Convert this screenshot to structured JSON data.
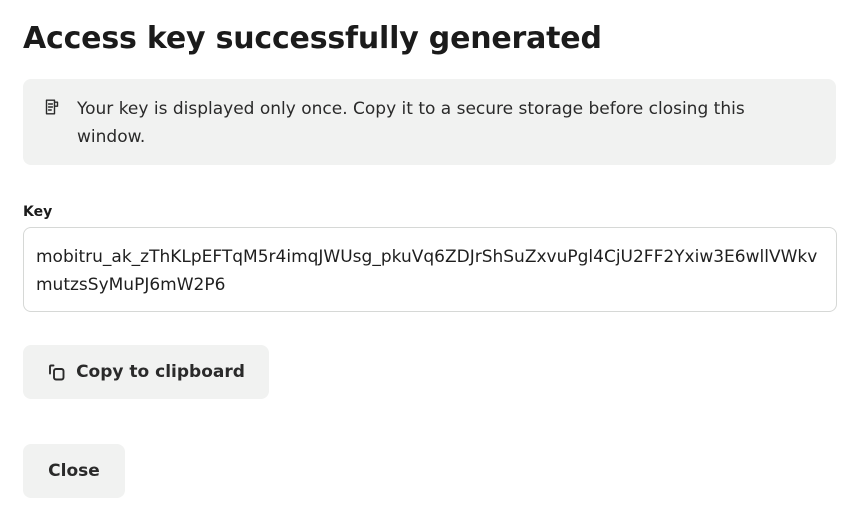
{
  "dialog": {
    "title": "Access key successfully generated",
    "notice": {
      "icon": "notice-document-icon",
      "text": "Your key is displayed only once. Copy it to a secure storage before closing this window."
    },
    "key": {
      "label": "Key",
      "value": "mobitru_ak_zThKLpEFTqM5r4imqJWUsg_pkuVq6ZDJrShSuZxvuPgl4CjU2FF2Yxiw3E6wllVWkvmutzsSyMuPJ6mW2P6"
    },
    "copy_button": {
      "icon": "copy-icon",
      "label": "Copy to clipboard"
    },
    "close_button": {
      "label": "Close"
    }
  },
  "colors": {
    "panel_background": "#f1f2f1",
    "border": "#d6d8d6",
    "text": "#1f1f1f"
  }
}
